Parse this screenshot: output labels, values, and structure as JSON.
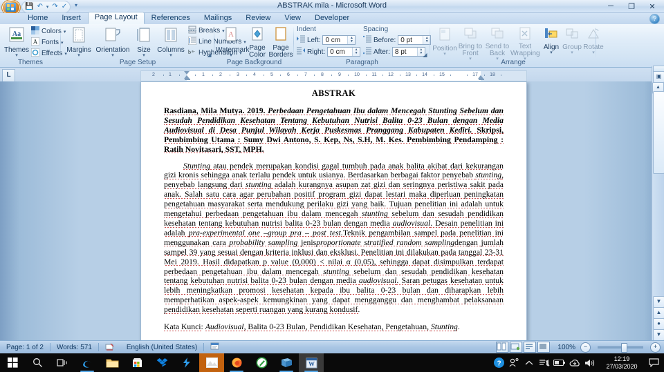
{
  "window": {
    "title": "ABSTRAK mila - Microsoft Word",
    "office_button": "office-orb",
    "quick_access": [
      {
        "name": "save",
        "glyph": "Ὃe"
      },
      {
        "name": "undo",
        "glyph": "↶"
      },
      {
        "name": "redo",
        "glyph": "↷"
      },
      {
        "name": "spelling",
        "glyph": "✓"
      }
    ],
    "controls": {
      "minimize": "─",
      "restore": "❐",
      "close": "✕"
    },
    "help": "?"
  },
  "tabs": [
    {
      "label": "Home",
      "active": false
    },
    {
      "label": "Insert",
      "active": false
    },
    {
      "label": "Page Layout",
      "active": true
    },
    {
      "label": "References",
      "active": false
    },
    {
      "label": "Mailings",
      "active": false
    },
    {
      "label": "Review",
      "active": false
    },
    {
      "label": "View",
      "active": false
    },
    {
      "label": "Developer",
      "active": false
    }
  ],
  "ribbon": {
    "groups": [
      {
        "name": "themes",
        "label": "Themes",
        "big": [
          {
            "label": "Themes",
            "caret": "▾"
          }
        ],
        "small": [
          {
            "label": "Colors",
            "caret": "▾"
          },
          {
            "label": "Fonts",
            "caret": "▾"
          },
          {
            "label": "Effects",
            "caret": "▾"
          }
        ]
      },
      {
        "name": "page-setup",
        "label": "Page Setup",
        "big": [
          {
            "label": "Margins",
            "caret": "▾"
          },
          {
            "label": "Orientation",
            "caret": "▾"
          },
          {
            "label": "Size",
            "caret": "▾"
          },
          {
            "label": "Columns",
            "caret": "▾"
          }
        ],
        "small": [
          {
            "label": "Breaks",
            "caret": "▾"
          },
          {
            "label": "Line Numbers",
            "caret": "▾"
          },
          {
            "label": "Hyphenation",
            "caret": "▾"
          }
        ]
      },
      {
        "name": "page-background",
        "label": "Page Background",
        "big": [
          {
            "label": "Watermark",
            "caret": "▾"
          },
          {
            "label": "Page Color",
            "caret": "▾"
          },
          {
            "label": "Page Borders",
            "caret": ""
          }
        ]
      },
      {
        "name": "paragraph",
        "label": "Paragraph",
        "indent_header": "Indent",
        "spacing_header": "Spacing",
        "fields": [
          {
            "label": "Left:",
            "value": "0 cm"
          },
          {
            "label": "Right:",
            "value": "0 cm"
          },
          {
            "label": "Before:",
            "value": "0 pt"
          },
          {
            "label": "After:",
            "value": "8 pt"
          }
        ]
      },
      {
        "name": "arrange",
        "label": "Arrange",
        "big": [
          {
            "label": "Position",
            "caret": "▾"
          },
          {
            "label": "Bring to Front",
            "caret": "▾"
          },
          {
            "label": "Send to Back",
            "caret": "▾"
          },
          {
            "label": "Text Wrapping",
            "caret": "▾"
          },
          {
            "label": "Align",
            "caret": "▾"
          },
          {
            "label": "Group",
            "caret": "▾"
          },
          {
            "label": "Rotate",
            "caret": "▾"
          }
        ]
      }
    ]
  },
  "ruler": {
    "tab_selector": "L",
    "left_ticks": [
      "2",
      "1"
    ],
    "right_ticks": [
      "1",
      "2",
      "3",
      "4",
      "5",
      "6",
      "7",
      "8",
      "9",
      "10",
      "11",
      "12",
      "13",
      "14",
      "15",
      "17",
      "18"
    ]
  },
  "document": {
    "title": "ABSTRAK",
    "citation_parts": [
      {
        "text": "Rasdiana, Mila Mutya. 2019. ",
        "style": "bold"
      },
      {
        "text": "Perbedaan Pengetahuan Ibu dalam Mencegah Stunting Sebelum dan Sesudah Pendidikan Kesehatan Tentang Kebutuhan Nutrisi Balita 0-23 Bulan dengan Media Audiovisual di Desa Punjul Wilayah Kerja Puskesmas Pranggang Kabupaten Kediri.",
        "style": "bold-italic"
      },
      {
        "text": " Skripsi, Pembimbing Utama : Sumy Dwi Antono, S. Kep, Ns, S.H, M. Kes. Pembimbing Pendamping : Ratih Novitasari, SST, MPH.",
        "style": "bold"
      }
    ],
    "body_parts": [
      {
        "text": "Stunting",
        "style": "italic"
      },
      {
        "text": " atau pendek merupakan kondisi gagal tumbuh pada anak balita akibat dari kekurangan gizi kronis sehingga anak terlalu pendek untuk usianya. Berdasarkan berbagai faktor penyebab ",
        "style": ""
      },
      {
        "text": "stunting",
        "style": "italic"
      },
      {
        "text": ", penyebab langsung dari ",
        "style": ""
      },
      {
        "text": "stunting",
        "style": "italic"
      },
      {
        "text": " adalah kurangnya asupan zat gizi dan seringnya peristiwa sakit pada anak. Salah satu cara agar perubahan positif program gizi dapat lestari maka diperluan peningkatan pengetahuan masyarakat serta mendukung perilaku gizi yang baik. Tujuan penelitian ini adalah untuk mengetahui perbedaan pengetahuan ibu dalam mencegah ",
        "style": ""
      },
      {
        "text": "stunting",
        "style": "italic"
      },
      {
        "text": " sebelum dan sesudah pendidikan kesehatan tentang kebutuhan nutrisi balita 0-23 bulan dengan media ",
        "style": ""
      },
      {
        "text": "audiovisual",
        "style": "italic"
      },
      {
        "text": ". Desain penelitian ini adalah ",
        "style": ""
      },
      {
        "text": "pra-experimental one –group pra – post test.",
        "style": "italic"
      },
      {
        "text": "Teknik pengambilan sampel pada penelitian ini menggunakan cara ",
        "style": ""
      },
      {
        "text": "probability sampling",
        "style": "italic"
      },
      {
        "text": " jenis",
        "style": ""
      },
      {
        "text": "proportionate stratified random sampling",
        "style": "italic"
      },
      {
        "text": "dengan jumlah sampel 39 yang sesuai dengan kriteria inklusi dan eksklusi. Penelitian ini dilakukan pada tanggal 23-31 Mei 2019. Hasil didapatkan p value (0,000) < nilai α (0,05), sehingga dapat disimpulkan terdapat perbedaan pengetahuan ibu dalam mencegah ",
        "style": ""
      },
      {
        "text": "stunting",
        "style": "italic"
      },
      {
        "text": " sebelum dan sesudah pendidikan kesehatan tentang kebutuhan nutrisi balita 0-23 bulan dengan media ",
        "style": ""
      },
      {
        "text": "audiovisual",
        "style": "italic"
      },
      {
        "text": ". Saran petugas kesehatan untuk lebih meningkatkan promosi kesehatan kepada ibu balita 0-23 bulan dan diharapkan lebih memperhatikan aspek-aspek kemungkinan yang dapat mengganggu dan menghambat pelaksanaan pendidikan kesehatan seperti ruangan yang kurang kondusif.",
        "style": ""
      }
    ],
    "keywords_parts": [
      {
        "text": "Kata Kunci",
        "style": ""
      },
      {
        "text": ": ",
        "style": ""
      },
      {
        "text": "Audiovisual",
        "style": "italic"
      },
      {
        "text": ", Balita 0-23 Bulan, Pendidikan Kesehatan, Pengetahuan, ",
        "style": ""
      },
      {
        "text": "Stunting",
        "style": "italic"
      },
      {
        "text": ".",
        "style": ""
      }
    ]
  },
  "status_bar": {
    "page": "Page: 1 of 2",
    "words": "Words: 571",
    "language": "English (United States)",
    "zoom": "100%",
    "zoom_out": "−",
    "zoom_in": "+",
    "views": [
      "print-layout",
      "full-screen-reading",
      "web-layout",
      "outline",
      "draft"
    ]
  },
  "taskbar": {
    "items": [
      {
        "name": "start",
        "glyph": "⊞"
      },
      {
        "name": "search",
        "glyph": "⚲"
      },
      {
        "name": "task-view",
        "glyph": "▣"
      },
      {
        "name": "edge",
        "glyph": "e"
      },
      {
        "name": "file-explorer",
        "glyph": "🗀"
      },
      {
        "name": "microsoft-store",
        "glyph": "🛍"
      },
      {
        "name": "dropbox",
        "glyph": "❖"
      },
      {
        "name": "lightning-app",
        "glyph": "⚡"
      },
      {
        "name": "photos",
        "glyph": "🏞"
      },
      {
        "name": "firefox",
        "glyph": "🦊"
      },
      {
        "name": "green-pen-app",
        "glyph": "✎"
      },
      {
        "name": "blue-book-app",
        "glyph": "📘"
      },
      {
        "name": "word",
        "glyph": "W"
      }
    ],
    "tray": [
      {
        "name": "help-circle",
        "glyph": "?"
      },
      {
        "name": "people",
        "glyph": "ᴿ"
      },
      {
        "name": "show-hidden",
        "glyph": "∧"
      },
      {
        "name": "network",
        "glyph": "☰"
      },
      {
        "name": "battery",
        "glyph": "▭"
      },
      {
        "name": "onedrive",
        "glyph": "☁"
      },
      {
        "name": "volume",
        "glyph": "🔊"
      }
    ],
    "clock_time": "12:19",
    "clock_date": "27/03/2020",
    "action_center": "▭"
  },
  "colors": {
    "ribbon_bg": "#e2eef9",
    "accent": "#2b6ca8",
    "doc_bg": "#b7cfe6",
    "status_bar": "#a9c6e4",
    "taskbar": "#0a0a0a",
    "taskbar_active": "#c2620f"
  }
}
